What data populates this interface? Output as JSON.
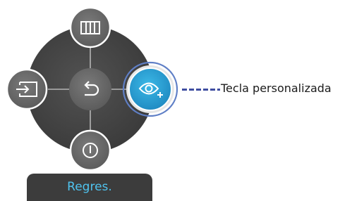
{
  "controls": {
    "up": {
      "icon": "picture-mode-icon"
    },
    "left": {
      "icon": "source-input-icon"
    },
    "center": {
      "icon": "return-icon"
    },
    "right": {
      "icon": "eye-plus-icon",
      "state": "selected"
    },
    "down": {
      "icon": "power-icon"
    }
  },
  "callout": {
    "text": "Tecla personalizada"
  },
  "back_label": {
    "text": "Regres."
  },
  "colors": {
    "pad": "#484848",
    "button": "#6b6b6b",
    "selected": "#2aa6d6",
    "accent_text": "#4fc3ef",
    "leader": "#3e4da0"
  }
}
